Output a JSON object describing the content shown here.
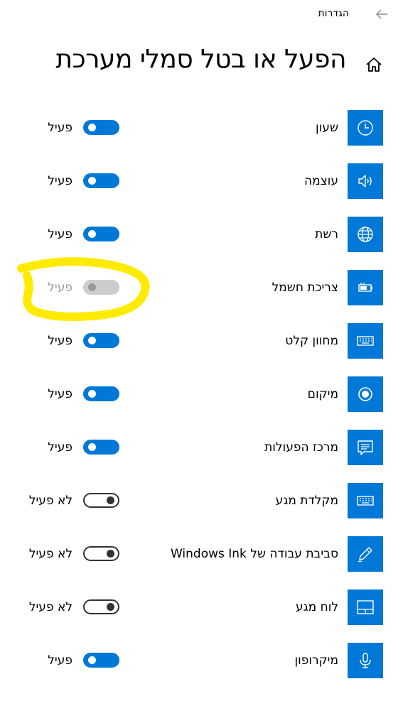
{
  "header": {
    "settings_label": "הגדרות"
  },
  "page": {
    "title": "הפעל או בטל סמלי מערכת"
  },
  "accent_color": "#0078d7",
  "highlight_color": "#ffeb00",
  "rows": [
    {
      "label": "שעון",
      "icon": "clock-icon",
      "state": "on",
      "state_label": "פעיל"
    },
    {
      "label": "עוצמה",
      "icon": "volume-icon",
      "state": "on",
      "state_label": "פעיל"
    },
    {
      "label": "רשת",
      "icon": "globe-icon",
      "state": "on",
      "state_label": "פעיל"
    },
    {
      "label": "צריכת חשמל",
      "icon": "battery-icon",
      "state": "disabled",
      "state_label": "פעיל"
    },
    {
      "label": "מחוון קלט",
      "icon": "keyboard-icon",
      "state": "on",
      "state_label": "פעיל"
    },
    {
      "label": "מיקום",
      "icon": "location-icon",
      "state": "on",
      "state_label": "פעיל"
    },
    {
      "label": "מרכז הפעולות",
      "icon": "action-center-icon",
      "state": "on",
      "state_label": "פעיל"
    },
    {
      "label": "מקלדת מגע",
      "icon": "touch-keyboard-icon",
      "state": "off",
      "state_label": "לא פעיל"
    },
    {
      "label": "סביבת עבודה של Windows Ink",
      "icon": "pen-icon",
      "state": "off",
      "state_label": "לא פעיל"
    },
    {
      "label": "לוח מגע",
      "icon": "touchpad-icon",
      "state": "off",
      "state_label": "לא פעיל"
    },
    {
      "label": "מיקרופון",
      "icon": "microphone-icon",
      "state": "on",
      "state_label": "פעיל"
    }
  ]
}
